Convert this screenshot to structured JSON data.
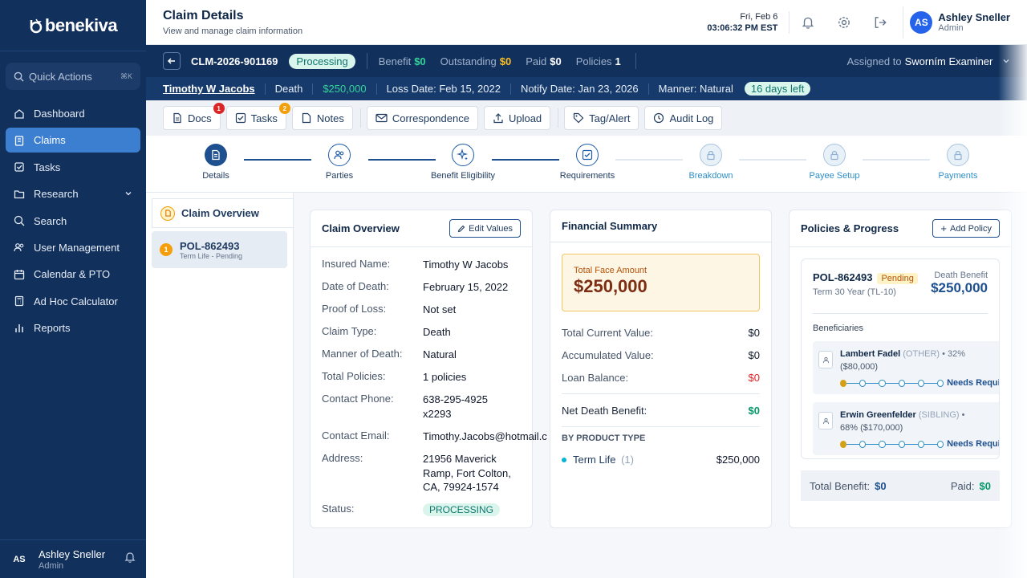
{
  "sidebar": {
    "logo": "benekiva",
    "quick_actions": "Quick Actions",
    "quick_actions_kbd": "⌘K",
    "items": [
      {
        "label": "Dashboard"
      },
      {
        "label": "Claims"
      },
      {
        "label": "Tasks"
      },
      {
        "label": "Research"
      },
      {
        "label": "Search"
      },
      {
        "label": "User Management"
      },
      {
        "label": "Calendar & PTO"
      },
      {
        "label": "Ad Hoc Calculator"
      },
      {
        "label": "Reports"
      }
    ],
    "user": {
      "initials": "AS",
      "name": "Ashley Sneller",
      "role": "Admin"
    }
  },
  "header": {
    "title": "Claim Details",
    "subtitle": "View and manage claim information",
    "date": "Fri, Feb 6",
    "time": "03:06:32 PM EST",
    "user": {
      "initials": "AS",
      "name": "Ashley Sneller",
      "role": "Admin"
    }
  },
  "claim": {
    "id": "CLM-2026-901169",
    "status": "Processing",
    "benefit_label": "Benefit",
    "benefit": "$0",
    "outstanding_label": "Outstanding",
    "outstanding": "$0",
    "paid_label": "Paid",
    "paid": "$0",
    "policies_label": "Policies",
    "policies": "1",
    "assigned_label": "Assigned to",
    "assigned": "Sworním Examiner",
    "insured": "Timothy W Jacobs",
    "type": "Death",
    "amount": "$250,000",
    "loss_date": "Loss Date: Feb 15, 2022",
    "notify_date": "Notify Date: Jan 23, 2026",
    "manner": "Manner: Natural",
    "days_left": "16 days left"
  },
  "toolbar": {
    "docs": "Docs",
    "docs_badge": "1",
    "tasks": "Tasks",
    "tasks_badge": "2",
    "notes": "Notes",
    "correspondence": "Correspondence",
    "upload": "Upload",
    "tag": "Tag/Alert",
    "audit": "Audit Log"
  },
  "steps": [
    {
      "label": "Details",
      "state": "current"
    },
    {
      "label": "Parties",
      "state": "done"
    },
    {
      "label": "Benefit Eligibility",
      "state": "done"
    },
    {
      "label": "Requirements",
      "state": "done"
    },
    {
      "label": "Breakdown",
      "state": "locked"
    },
    {
      "label": "Payee Setup",
      "state": "locked"
    },
    {
      "label": "Payments",
      "state": "locked"
    }
  ],
  "left_panel": {
    "title": "Claim Overview",
    "policy_num": "1",
    "policy": "POL-862493",
    "policy_sub": "Term Life - Pending"
  },
  "overview": {
    "title": "Claim Overview",
    "edit": "Edit Values",
    "rows": [
      {
        "k": "Insured Name:",
        "v": "Timothy W Jacobs"
      },
      {
        "k": "Date of Death:",
        "v": "February 15, 2022"
      },
      {
        "k": "Proof of Loss:",
        "v": "Not set"
      },
      {
        "k": "Claim Type:",
        "v": "Death"
      },
      {
        "k": "Manner of Death:",
        "v": "Natural"
      },
      {
        "k": "Total Policies:",
        "v": "1 policies"
      },
      {
        "k": "Contact Phone:",
        "v1": "638-295-4925",
        "v2": "x2293"
      },
      {
        "k": "Contact Email:",
        "v": "Timothy.Jacobs@hotmail.c"
      },
      {
        "k": "Address:",
        "v1": "21956 Maverick",
        "v2": "Ramp, Fort Colton,",
        "v3": "CA, 79924-1574"
      },
      {
        "k": "Status:",
        "v": "PROCESSING"
      }
    ]
  },
  "financial": {
    "title": "Financial Summary",
    "face_label": "Total Face Amount",
    "face": "$250,000",
    "rows": [
      {
        "k": "Total Current Value:",
        "v": "$0"
      },
      {
        "k": "Accumulated Value:",
        "v": "$0"
      },
      {
        "k": "Loan Balance:",
        "v": "$0"
      }
    ],
    "net_label": "Net Death Benefit:",
    "net": "$0",
    "by_type": "BY PRODUCT TYPE",
    "type_name": "Term Life",
    "type_count": "(1)",
    "type_amount": "$250,000"
  },
  "policies": {
    "title": "Policies & Progress",
    "add": "Add Policy",
    "policy": "POL-862493",
    "status": "Pending",
    "term": "Term 30 Year (TL-10)",
    "db_label": "Death Benefit",
    "db": "$250,000",
    "bene_title": "Beneficiaries",
    "bene": [
      {
        "name": "Lambert Fadel",
        "rel": "(OTHER)",
        "pct": "• 32%",
        "amt": "($80,000)",
        "status": "Needs Requireme"
      },
      {
        "name": "Erwin Greenfelder",
        "rel": "(SIBLING)",
        "pct": "•",
        "amt": "68% ($170,000)",
        "status": "Needs Requireme"
      }
    ],
    "total_label": "Total Benefit:",
    "total": "$0",
    "paid_label": "Paid:",
    "paid": "$0"
  }
}
